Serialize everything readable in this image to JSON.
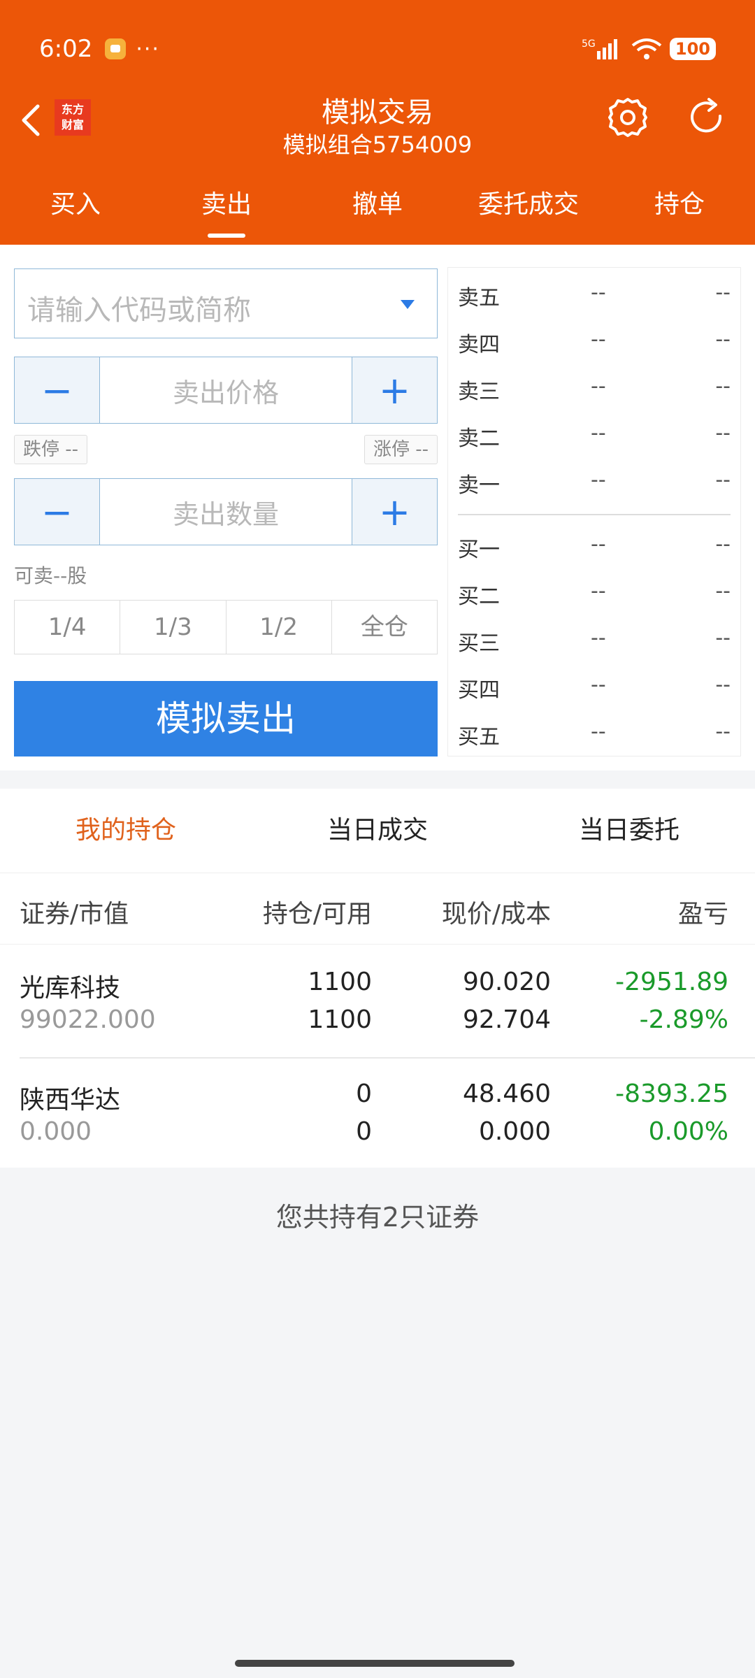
{
  "status": {
    "time": "6:02",
    "more": "···",
    "network": "5G",
    "battery": "100"
  },
  "nav": {
    "logo": "东方财富",
    "title": "模拟交易",
    "subtitle": "模拟组合5754009"
  },
  "tabs": [
    "买入",
    "卖出",
    "撤单",
    "委托成交",
    "持仓"
  ],
  "form": {
    "search_placeholder": "请输入代码或简称",
    "price_placeholder": "卖出价格",
    "qty_placeholder": "卖出数量",
    "minus": "−",
    "plus": "+",
    "limit_down": "跌停 --",
    "limit_up": "涨停 --",
    "available": "可卖--股",
    "ratios": [
      "1/4",
      "1/3",
      "1/2",
      "全仓"
    ],
    "sell_button": "模拟卖出"
  },
  "order_book": {
    "asks": [
      {
        "label": "卖五",
        "price": "--",
        "vol": "--"
      },
      {
        "label": "卖四",
        "price": "--",
        "vol": "--"
      },
      {
        "label": "卖三",
        "price": "--",
        "vol": "--"
      },
      {
        "label": "卖二",
        "price": "--",
        "vol": "--"
      },
      {
        "label": "卖一",
        "price": "--",
        "vol": "--"
      }
    ],
    "bids": [
      {
        "label": "买一",
        "price": "--",
        "vol": "--"
      },
      {
        "label": "买二",
        "price": "--",
        "vol": "--"
      },
      {
        "label": "买三",
        "price": "--",
        "vol": "--"
      },
      {
        "label": "买四",
        "price": "--",
        "vol": "--"
      },
      {
        "label": "买五",
        "price": "--",
        "vol": "--"
      }
    ]
  },
  "positions": {
    "tabs": [
      "我的持仓",
      "当日成交",
      "当日委托"
    ],
    "headers": [
      "证券/市值",
      "持仓/可用",
      "现价/成本",
      "盈亏"
    ],
    "rows": [
      {
        "name": "光库科技",
        "market_value": "99022.000",
        "hold": "1100",
        "avail": "1100",
        "price": "90.020",
        "cost": "92.704",
        "pnl": "-2951.89",
        "pnl_pct": "-2.89%"
      },
      {
        "name": "陕西华达",
        "market_value": "0.000",
        "hold": "0",
        "avail": "0",
        "price": "48.460",
        "cost": "0.000",
        "pnl": "-8393.25",
        "pnl_pct": "0.00%"
      }
    ],
    "summary": "您共持有2只证券"
  }
}
